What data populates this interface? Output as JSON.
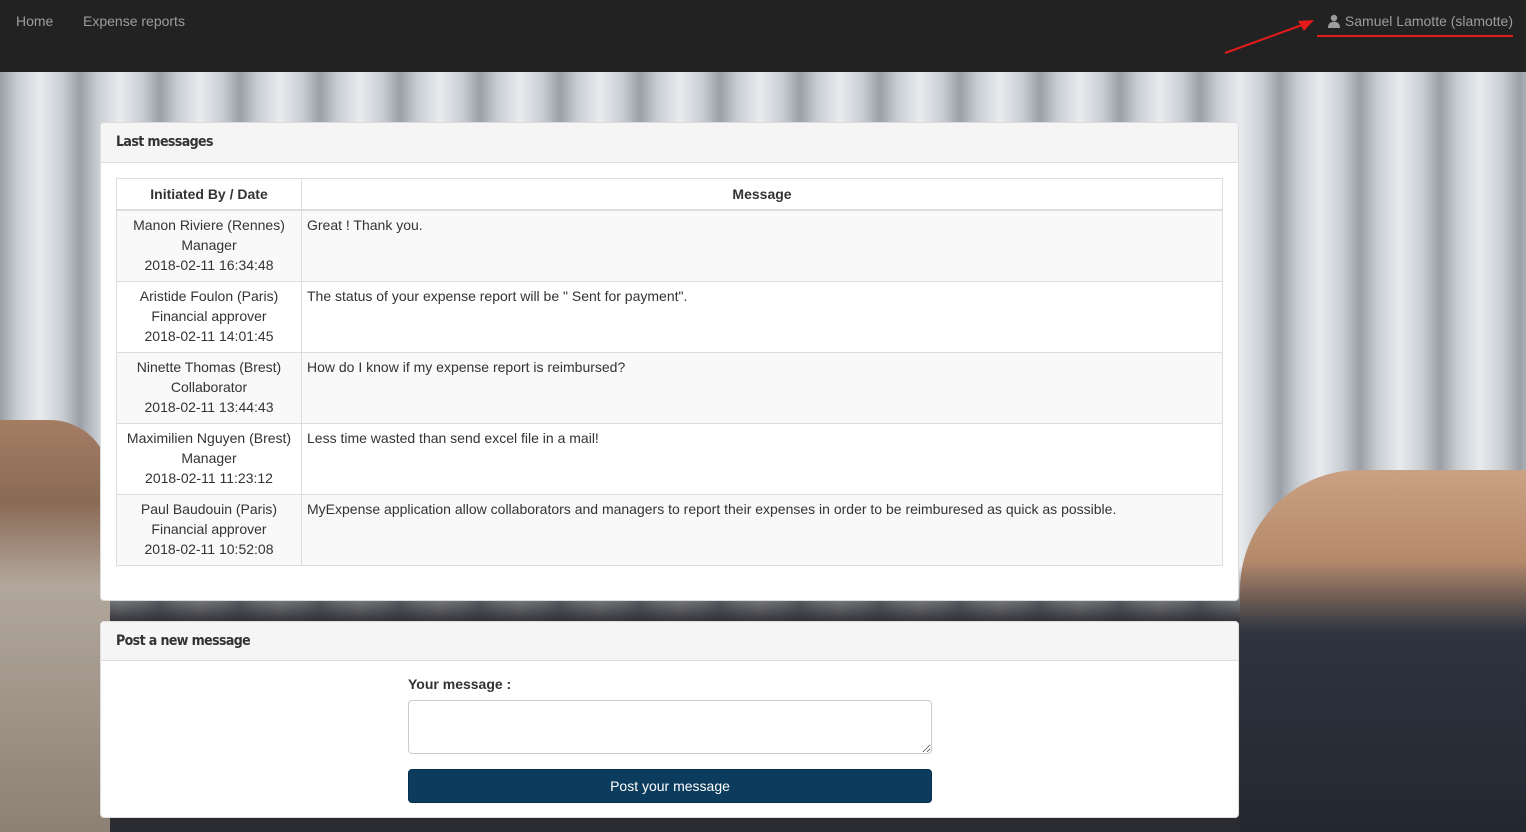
{
  "nav": {
    "home": "Home",
    "expense_reports": "Expense reports",
    "user": "Samuel Lamotte (slamotte)"
  },
  "colors": {
    "navbar": "#222222",
    "annotation": "#e41b1b",
    "button": "#0b3c5d"
  },
  "messages_panel": {
    "title": "Last messages",
    "col_initiated": "Initiated By / Date",
    "col_message": "Message",
    "rows": [
      {
        "who": "Manon Riviere (Rennes)",
        "role": "Manager",
        "date": "2018-02-11 16:34:48",
        "message": "Great ! Thank you."
      },
      {
        "who": "Aristide Foulon (Paris)",
        "role": "Financial approver",
        "date": "2018-02-11 14:01:45",
        "message": "The status of your expense report will be \" Sent for payment\"."
      },
      {
        "who": "Ninette Thomas (Brest)",
        "role": "Collaborator",
        "date": "2018-02-11 13:44:43",
        "message": "How do I know if my expense report is reimbursed?"
      },
      {
        "who": "Maximilien Nguyen (Brest)",
        "role": "Manager",
        "date": "2018-02-11 11:23:12",
        "message": "Less time wasted than send excel file in a mail!"
      },
      {
        "who": "Paul Baudouin (Paris)",
        "role": "Financial approver",
        "date": "2018-02-11 10:52:08",
        "message": "MyExpense application allow collaborators and managers to report their expenses in order to be reimburesed as quick as possible."
      }
    ]
  },
  "post_panel": {
    "title": "Post a new message",
    "label": "Your message :",
    "textarea_value": "",
    "button": "Post your message"
  },
  "icons": {
    "user": "user-icon",
    "arrow": "red-arrow-annotation"
  }
}
